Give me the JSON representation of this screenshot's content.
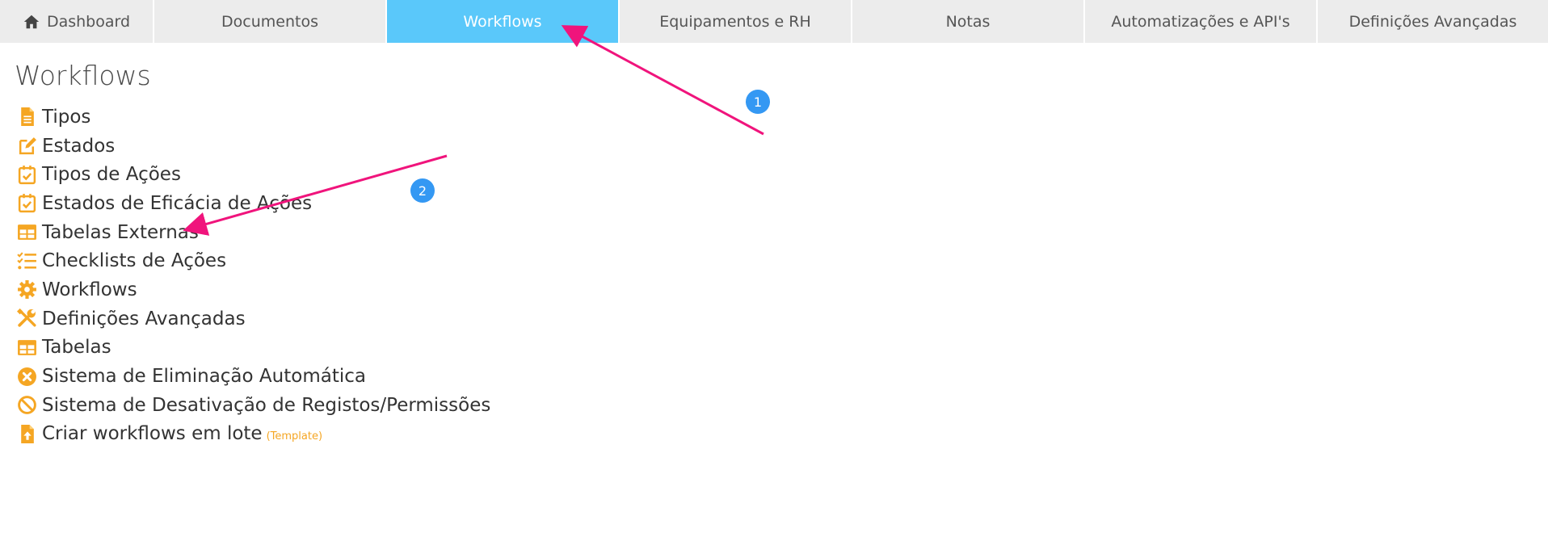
{
  "nav": {
    "tabs": [
      {
        "label": "Dashboard",
        "icon": "home-icon"
      },
      {
        "label": "Documentos"
      },
      {
        "label": "Workflows",
        "active": true
      },
      {
        "label": "Equipamentos e RH"
      },
      {
        "label": "Notas"
      },
      {
        "label": "Automatizações e API's"
      },
      {
        "label": "Definições Avançadas"
      }
    ]
  },
  "page": {
    "title": "Workflows"
  },
  "menu": {
    "items": [
      {
        "label": "Tipos",
        "icon": "file-text-icon"
      },
      {
        "label": "Estados",
        "icon": "edit-icon"
      },
      {
        "label": "Tipos de Ações",
        "icon": "calendar-check-icon"
      },
      {
        "label": "Estados de Eficácia de Ações",
        "icon": "calendar-check-icon"
      },
      {
        "label": "Tabelas Externas",
        "icon": "table-icon"
      },
      {
        "label": "Checklists de Ações",
        "icon": "checklist-icon"
      },
      {
        "label": "Workflows",
        "icon": "gear-icon"
      },
      {
        "label": "Definições Avançadas",
        "icon": "tools-icon"
      },
      {
        "label": "Tabelas",
        "icon": "table-icon"
      },
      {
        "label": "Sistema de Eliminação Automática",
        "icon": "times-circle-icon"
      },
      {
        "label": "Sistema de Desativação de Registos/Permissões",
        "icon": "ban-icon"
      },
      {
        "label": "Criar workflows em lote",
        "icon": "file-upload-icon",
        "extra": "(Template)"
      }
    ]
  },
  "annotations": {
    "badge1": "1",
    "badge2": "2"
  },
  "colors": {
    "accent": "#f5a623",
    "active_tab": "#5ac8fa",
    "tab_bg": "#ececec",
    "arrow": "#f0147c",
    "badge": "#3498f3"
  }
}
